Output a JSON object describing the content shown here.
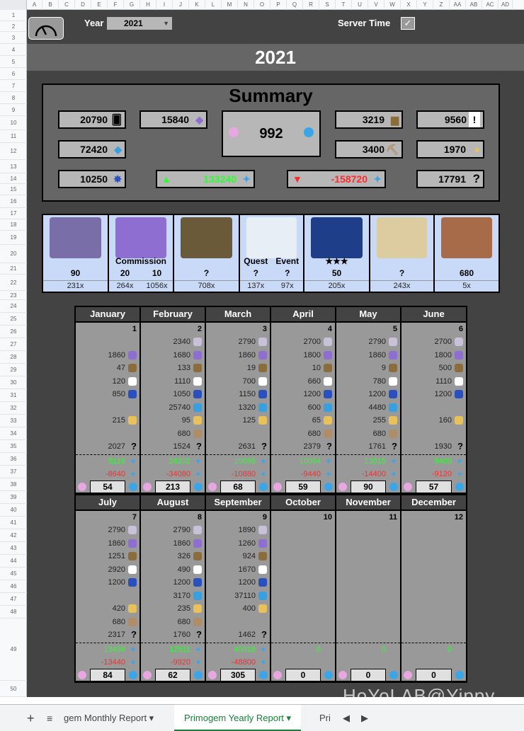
{
  "header": {
    "year_label": "Year",
    "year_value": "2021",
    "server_time_label": "Server Time",
    "server_time_check": "✓"
  },
  "year_title": "2021",
  "summary": {
    "title": "Summary",
    "primogems": "20790",
    "commission": "15840",
    "quest": "3219",
    "event": "9560",
    "starglitter": "72420",
    "achievements": "1970",
    "chest": "3400",
    "abyss": "10250",
    "income": "133240",
    "expense": "-158720",
    "unknown": "17791",
    "center_value": "992"
  },
  "tiles": [
    {
      "label": "",
      "count": "90",
      "mult": "231x",
      "color": "#7a6ea8"
    },
    {
      "label": "Commission",
      "count": "20",
      "count2": "10",
      "mult": "264x",
      "mult2": "1056x",
      "color": "#8e6fd1"
    },
    {
      "label": "",
      "count": "?",
      "mult": "708x",
      "color": "#6b5a3a"
    },
    {
      "label": "Quest",
      "label2": "Event",
      "count": "?",
      "count2": "?",
      "mult": "137x",
      "mult2": "97x",
      "color": "#e8eef5"
    },
    {
      "label": "★★★",
      "count": "50",
      "mult": "205x",
      "color": "#1e3e8a"
    },
    {
      "label": "",
      "count": "?",
      "mult": "243x",
      "color": "#dccca0"
    },
    {
      "label": "",
      "count": "680",
      "mult": "5x",
      "color": "#a86b4a"
    }
  ],
  "months": [
    {
      "name": "January",
      "day": "1",
      "rows": [
        "",
        "1860",
        "47",
        "120",
        "850",
        "",
        "215",
        "",
        "2027"
      ],
      "inc": "5118",
      "dec": "-8640",
      "total": "54"
    },
    {
      "name": "February",
      "day": "2",
      "rows": [
        "2340",
        "1680",
        "133",
        "1110",
        "1050",
        "25740",
        "95",
        "680",
        "1524"
      ],
      "inc": "24202",
      "dec": "-34080",
      "total": "213"
    },
    {
      "name": "March",
      "day": "3",
      "rows": [
        "2790",
        "1860",
        "19",
        "700",
        "1150",
        "1320",
        "125",
        "",
        "2631"
      ],
      "inc": "10695",
      "dec": "-10880",
      "total": "68"
    },
    {
      "name": "April",
      "day": "4",
      "rows": [
        "2700",
        "1800",
        "10",
        "660",
        "1200",
        "600",
        "65",
        "680",
        "2379"
      ],
      "inc": "10094",
      "dec": "-9440",
      "total": "59"
    },
    {
      "name": "May",
      "day": "5",
      "rows": [
        "2790",
        "1860",
        "9",
        "780",
        "1200",
        "4480",
        "255",
        "680",
        "1761"
      ],
      "inc": "13815",
      "dec": "-14400",
      "total": "90"
    },
    {
      "name": "June",
      "day": "6",
      "rows": [
        "2700",
        "1800",
        "500",
        "1110",
        "1200",
        "",
        "160",
        "",
        "1930"
      ],
      "inc": "9400",
      "dec": "-9120",
      "total": "57"
    },
    {
      "name": "July",
      "day": "7",
      "rows": [
        "2790",
        "1860",
        "1251",
        "2920",
        "1200",
        "",
        "420",
        "680",
        "2317"
      ],
      "inc": "13438",
      "dec": "-13440",
      "total": "84"
    },
    {
      "name": "August",
      "day": "8",
      "rows": [
        "2790",
        "1860",
        "326",
        "490",
        "1200",
        "3170",
        "235",
        "680",
        "1760"
      ],
      "inc": "12511",
      "dec": "-9920",
      "total": "62"
    },
    {
      "name": "September",
      "day": "9",
      "rows": [
        "1890",
        "1260",
        "924",
        "1670",
        "1200",
        "37110",
        "400",
        "",
        "1462"
      ],
      "inc": "45916",
      "dec": "-48800",
      "total": "305"
    },
    {
      "name": "October",
      "day": "10",
      "rows": [
        "",
        "",
        "",
        "",
        "",
        "",
        "",
        "",
        ""
      ],
      "inc": "0",
      "dec": "",
      "total": "0"
    },
    {
      "name": "November",
      "day": "11",
      "rows": [
        "",
        "",
        "",
        "",
        "",
        "",
        "",
        "",
        ""
      ],
      "inc": "0",
      "dec": "",
      "total": "0"
    },
    {
      "name": "December",
      "day": "12",
      "rows": [
        "",
        "",
        "",
        "",
        "",
        "",
        "",
        "",
        ""
      ],
      "inc": "0",
      "dec": "",
      "total": "0"
    }
  ],
  "colors": {
    "primogem": "#c9c0d9",
    "commission": "#8e6fd1",
    "chest": "#8a6d3b",
    "quest": "#ffffff",
    "abyss": "#2a4fbf",
    "star": "#39a0e0",
    "achieve": "#e8c15a",
    "chest2": "#b08d66",
    "unknown": "#000000"
  },
  "tabs": {
    "t1": "gem Monthly Report",
    "t2": "Primogem Yearly Report",
    "t3": "Pri"
  },
  "watermark": "HoYoLAB@Yippy",
  "colheaders": [
    "A",
    "B",
    "C",
    "D",
    "E",
    "F",
    "G",
    "H",
    "I",
    "J",
    "K",
    "L",
    "M",
    "N",
    "O",
    "P",
    "Q",
    "R",
    "S",
    "T",
    "U",
    "V",
    "W",
    "X",
    "Y",
    "Z",
    "AA",
    "AB",
    "AC",
    "AD"
  ]
}
